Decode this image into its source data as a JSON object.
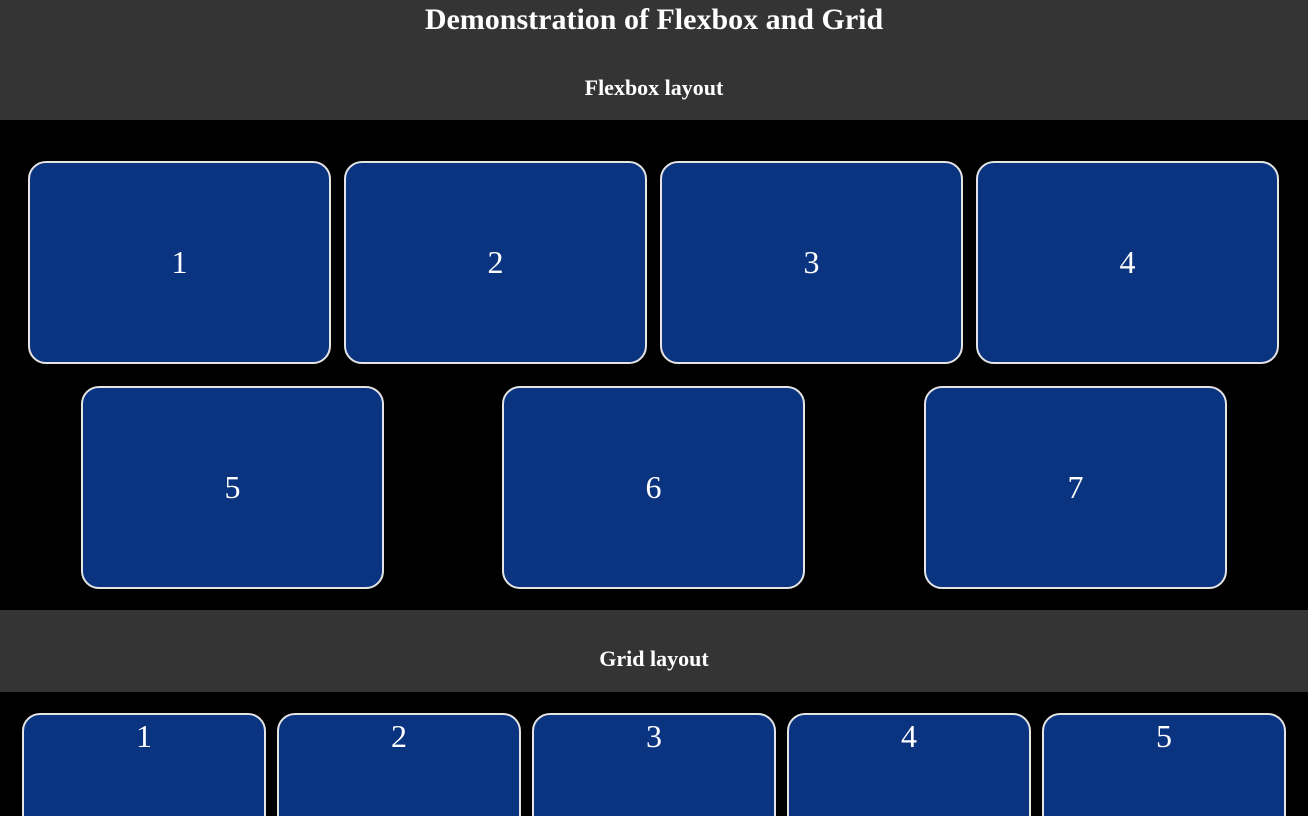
{
  "page": {
    "title": "Demonstration of Flexbox and Grid"
  },
  "flexbox": {
    "heading": "Flexbox layout",
    "items": [
      "1",
      "2",
      "3",
      "4",
      "5",
      "6",
      "7"
    ]
  },
  "grid": {
    "heading": "Grid layout",
    "items": [
      "1",
      "2",
      "3",
      "4",
      "5"
    ]
  },
  "colors": {
    "header_background": "#343434",
    "area_background": "#000000",
    "box_fill": "#0a3380",
    "box_border": "#e4e4e4",
    "text": "#ffffff"
  }
}
